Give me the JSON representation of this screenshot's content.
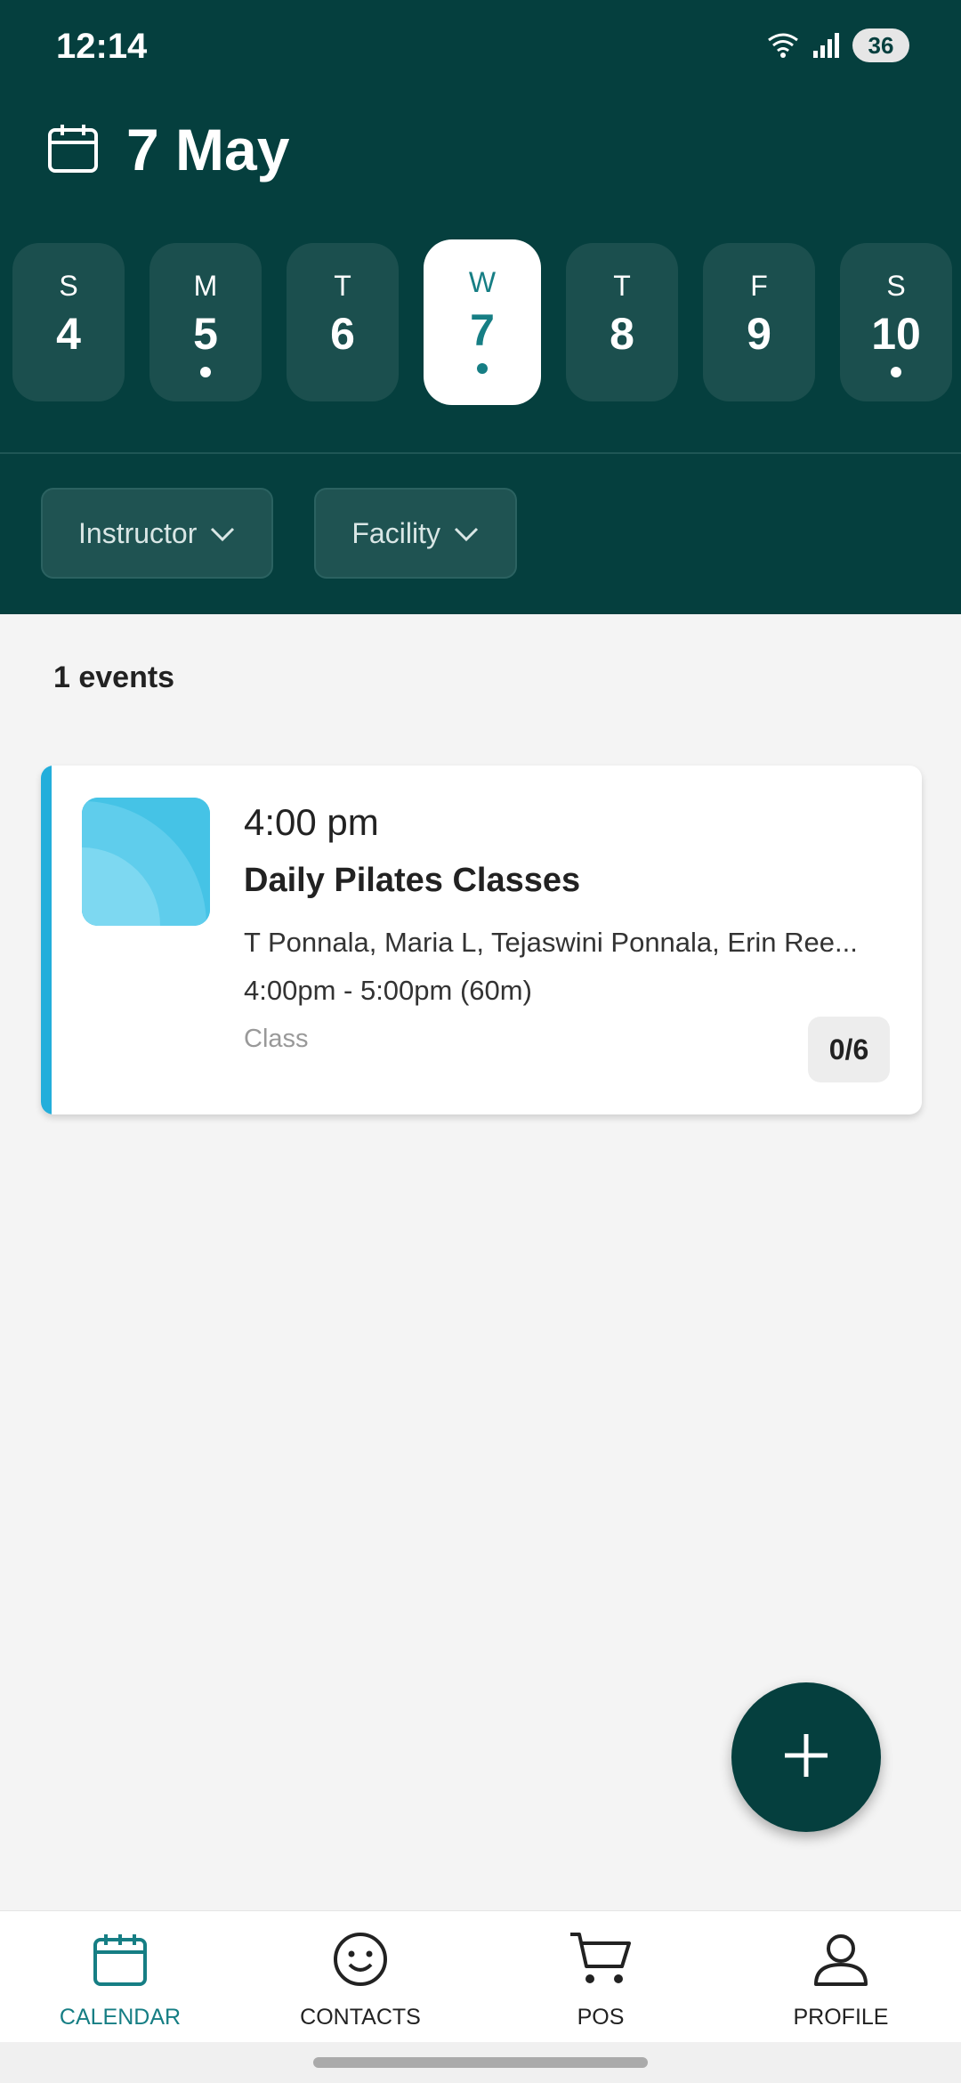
{
  "status_bar": {
    "time": "12:14",
    "battery": "36"
  },
  "header": {
    "date_title": "7 May"
  },
  "week": [
    {
      "dow": "S",
      "num": "4",
      "has_event": false,
      "selected": false
    },
    {
      "dow": "M",
      "num": "5",
      "has_event": true,
      "selected": false
    },
    {
      "dow": "T",
      "num": "6",
      "has_event": false,
      "selected": false
    },
    {
      "dow": "W",
      "num": "7",
      "has_event": true,
      "selected": true
    },
    {
      "dow": "T",
      "num": "8",
      "has_event": false,
      "selected": false
    },
    {
      "dow": "F",
      "num": "9",
      "has_event": false,
      "selected": false
    },
    {
      "dow": "S",
      "num": "10",
      "has_event": true,
      "selected": false
    }
  ],
  "filters": {
    "instructor": "Instructor",
    "facility": "Facility"
  },
  "events_count": "1 events",
  "event": {
    "time": "4:00 pm",
    "title": "Daily Pilates Classes",
    "people": "T Ponnala, Maria L, Tejaswini Ponnala, Erin Ree...",
    "duration": "4:00pm - 5:00pm (60m)",
    "type": "Class",
    "capacity": "0/6",
    "accent_color": "#23aedb"
  },
  "bottom_nav": [
    {
      "label": "CALENDAR",
      "icon": "calendar-icon",
      "active": true
    },
    {
      "label": "CONTACTS",
      "icon": "smiley-icon",
      "active": false
    },
    {
      "label": "POS",
      "icon": "cart-icon",
      "active": false
    },
    {
      "label": "PROFILE",
      "icon": "person-icon",
      "active": false
    }
  ],
  "colors": {
    "header_bg": "#053f3e",
    "accent": "#167e84"
  }
}
